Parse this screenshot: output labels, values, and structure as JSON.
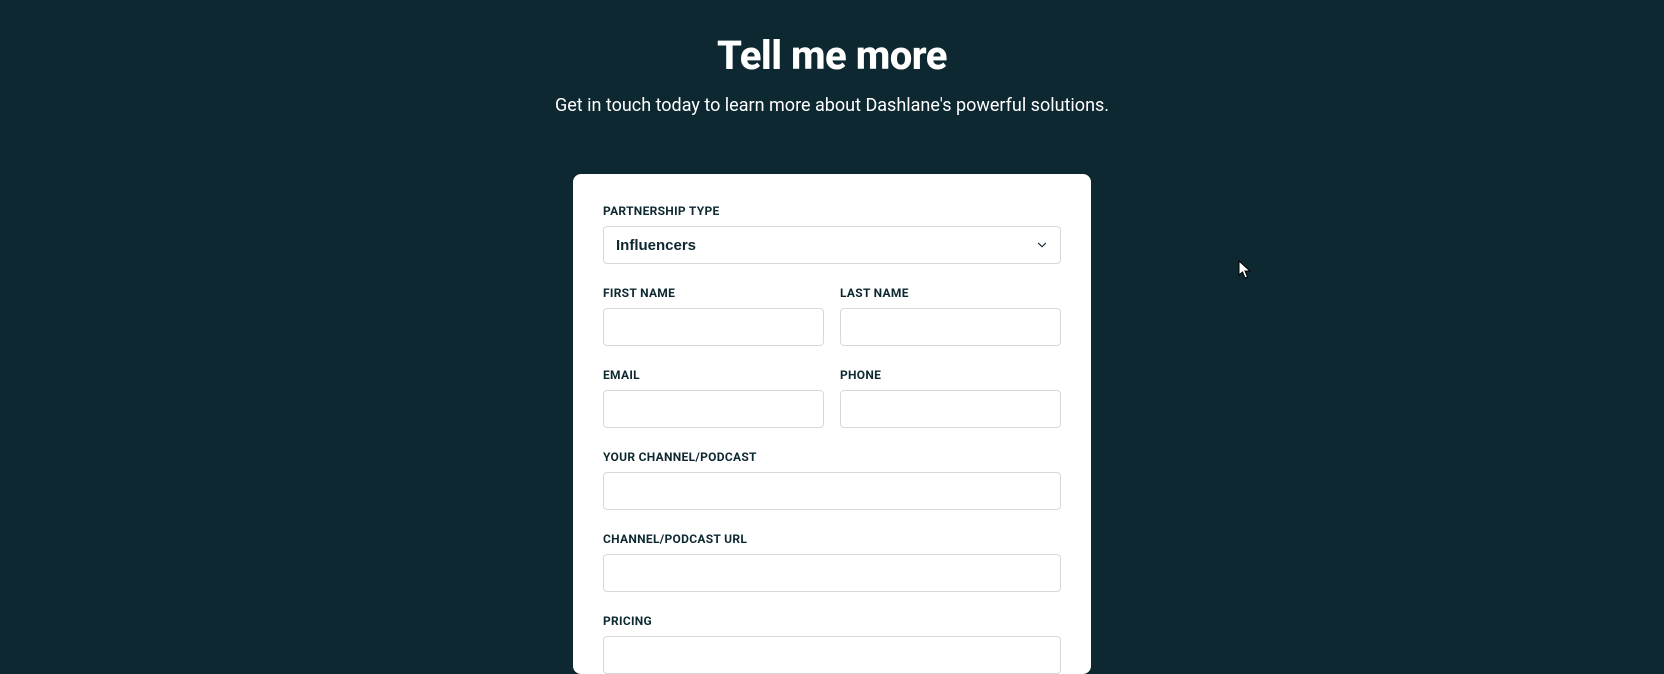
{
  "header": {
    "title": "Tell me more",
    "subtitle": "Get in touch today to learn more about Dashlane's powerful solutions."
  },
  "form": {
    "partnership_type": {
      "label": "PARTNERSHIP TYPE",
      "selected": "Influencers"
    },
    "first_name": {
      "label": "FIRST NAME",
      "value": ""
    },
    "last_name": {
      "label": "LAST NAME",
      "value": ""
    },
    "email": {
      "label": "EMAIL",
      "value": ""
    },
    "phone": {
      "label": "PHONE",
      "value": ""
    },
    "channel_podcast": {
      "label": "YOUR CHANNEL/PODCAST",
      "value": ""
    },
    "channel_podcast_url": {
      "label": "CHANNEL/PODCAST URL",
      "value": ""
    },
    "pricing": {
      "label": "PRICING",
      "value": ""
    }
  }
}
